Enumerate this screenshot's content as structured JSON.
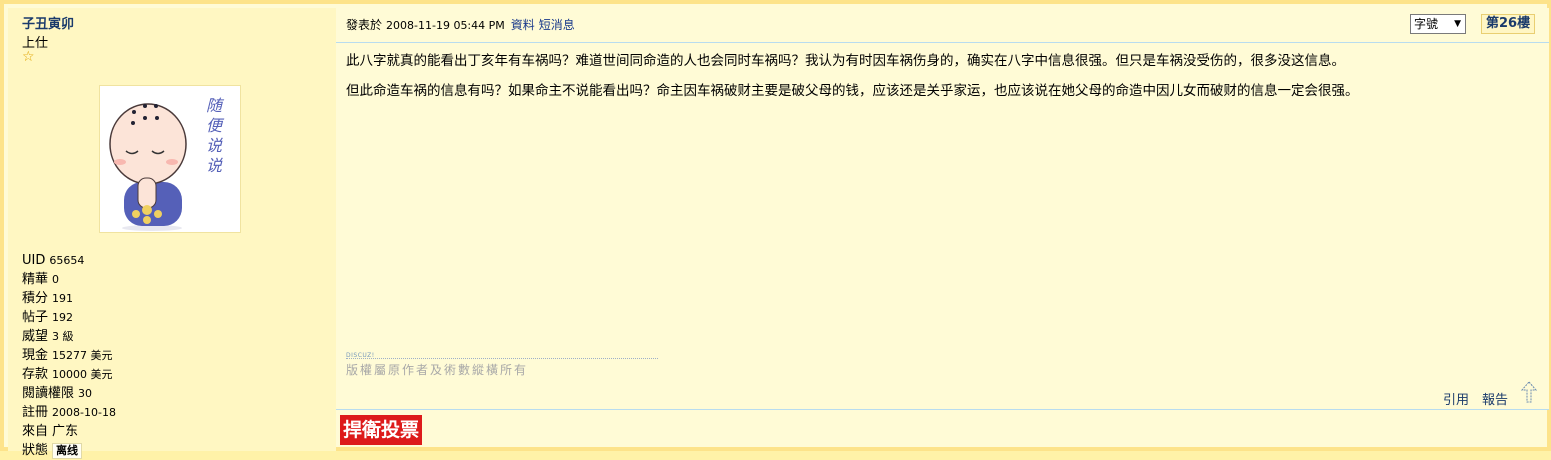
{
  "profile": {
    "username": "子丑寅卯",
    "rank": "上仕",
    "avatar_text": "随便说说",
    "stats": [
      {
        "key": "UID",
        "value": "65654"
      },
      {
        "key": "精華",
        "value": "0"
      },
      {
        "key": "積分",
        "value": "191"
      },
      {
        "key": "帖子",
        "value": "192"
      },
      {
        "key": "威望",
        "value": "3 級"
      },
      {
        "key": "現金",
        "value": "15277 美元"
      },
      {
        "key": "存款",
        "value": "10000 美元"
      },
      {
        "key": "閱讀權限",
        "value": "30"
      },
      {
        "key": "註冊",
        "value": "2008-10-18"
      },
      {
        "key": "來自",
        "value": "广东"
      }
    ],
    "status_key": "狀態",
    "status_value": "离线"
  },
  "post": {
    "posted_label": "發表於",
    "date": "2008-11-19 05:44 PM",
    "profile_link": "資料",
    "message_link": "短消息",
    "fontsize_label": "字號",
    "floor": "第26樓",
    "paragraphs": [
      "此八字就真的能看出丁亥年有车祸吗？难道世间同命造的人也会同时车祸吗？我认为有时因车祸伤身的，确实在八字中信息很强。但只是车祸没受伤的，很多没这信息。",
      "但此命造车祸的信息有吗？如果命主不说能看出吗？命主因车祸破财主要是破父母的钱，应该还是关乎家运，也应该说在她父母的命造中因儿女而破财的信息一定会很强。"
    ],
    "sig_label": "DISCUZ!",
    "copyright": "版權屬原作者及術數縱橫所有",
    "reply_label": "引用",
    "report_label": "報告"
  },
  "vote_banner": "捍衛投票"
}
